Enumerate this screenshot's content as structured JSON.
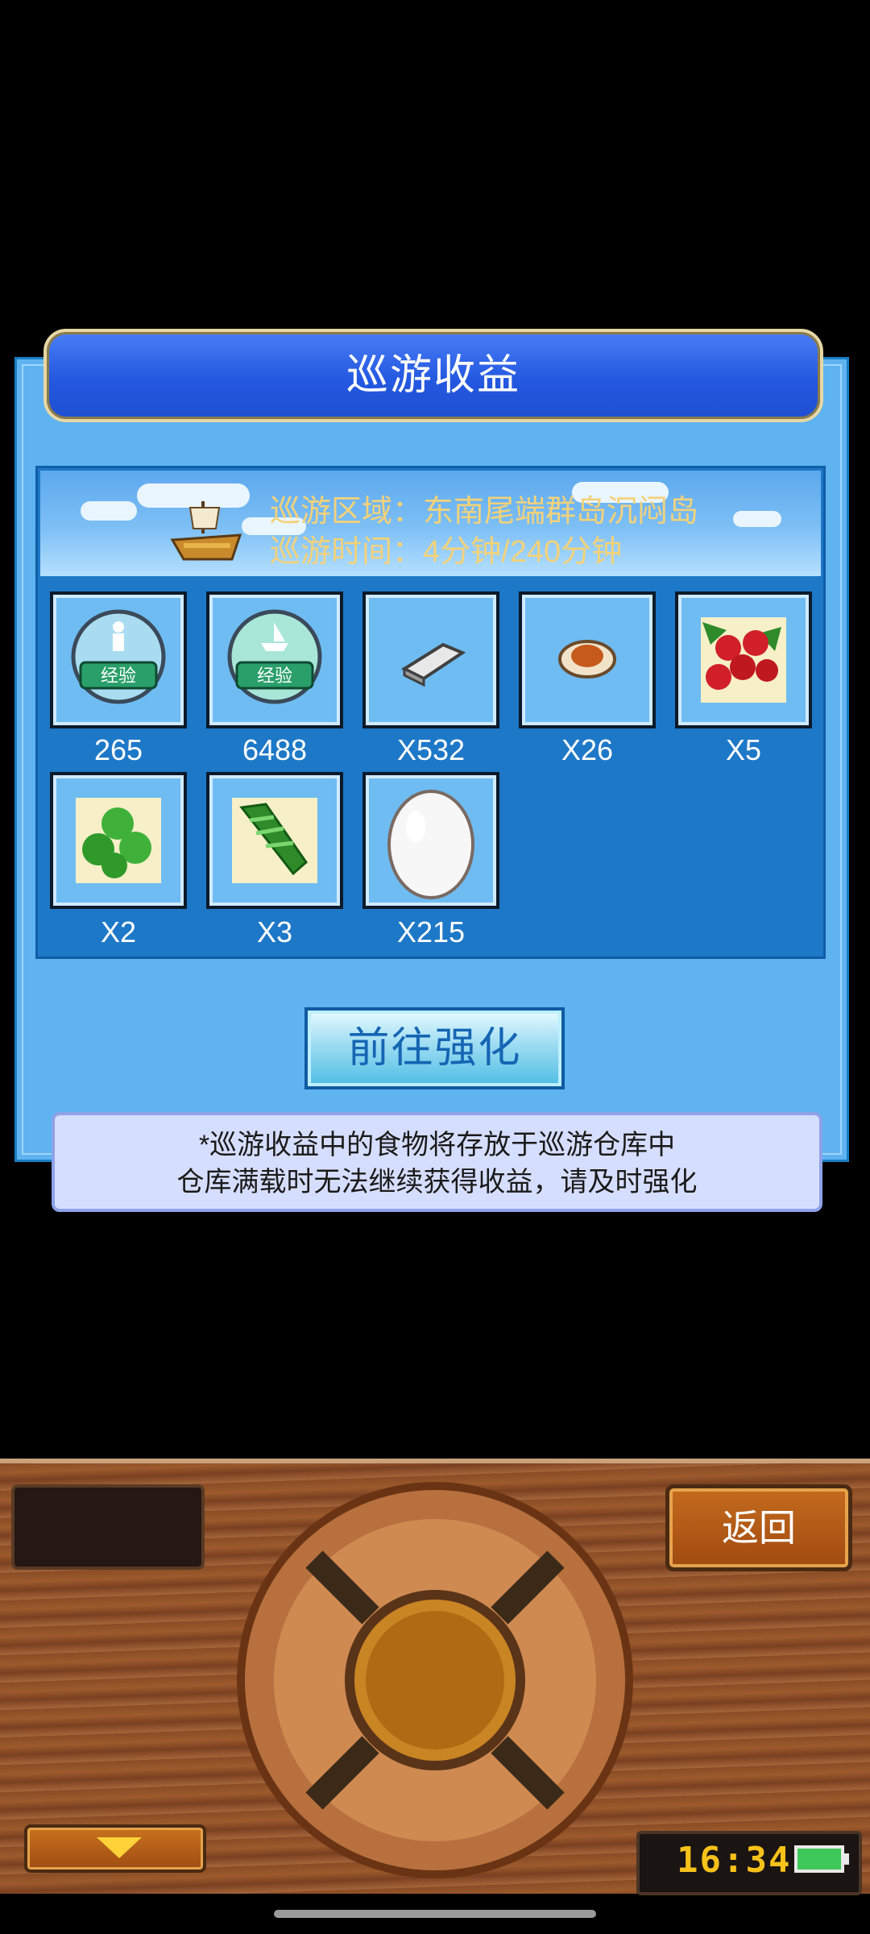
{
  "dialog": {
    "title": "巡游收益",
    "region": "巡游区域：东南尾端群岛沉闷岛",
    "time": "巡游时间：4分钟/240分钟",
    "items": [
      {
        "icon": "exp-person-icon",
        "label": "265"
      },
      {
        "icon": "exp-boat-icon",
        "label": "6488"
      },
      {
        "icon": "silver-ingot-icon",
        "label": "X532"
      },
      {
        "icon": "meat-icon",
        "label": "X26"
      },
      {
        "icon": "red-berries-icon",
        "label": "X5"
      },
      {
        "icon": "green-peas-icon",
        "label": "X2"
      },
      {
        "icon": "green-vegetable-icon",
        "label": "X3"
      },
      {
        "icon": "egg-icon",
        "label": "X215"
      }
    ],
    "strengthen_button": "前往强化",
    "notice_line1": "*巡游收益中的食物将存放于巡游仓库中",
    "notice_line2": "仓库满载时无法继续获得收益，请及时强化"
  },
  "console": {
    "back_label": "返回",
    "clock": "16:34"
  }
}
